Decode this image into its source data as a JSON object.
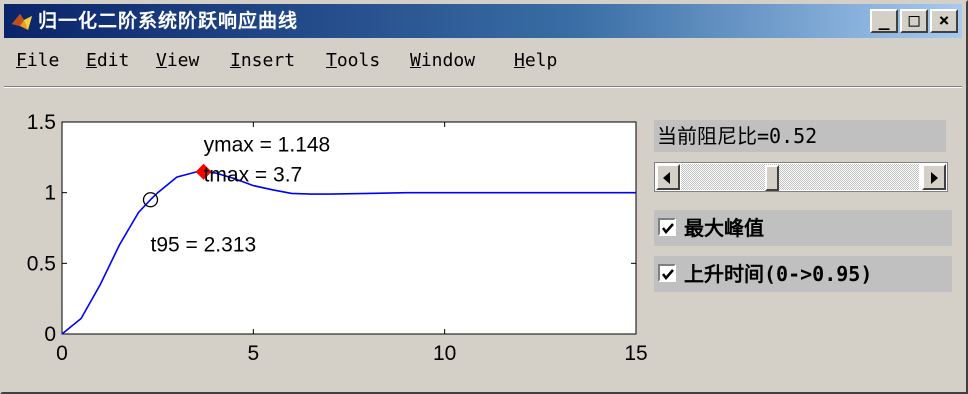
{
  "window": {
    "title": "归一化二阶系统阶跃响应曲线",
    "controls": {
      "minimize": "_",
      "maximize": "□",
      "close": "×"
    }
  },
  "menu": {
    "items": [
      {
        "id": "file",
        "label": "File"
      },
      {
        "id": "edit",
        "label": "Edit"
      },
      {
        "id": "view",
        "label": "View"
      },
      {
        "id": "insert",
        "label": "Insert"
      },
      {
        "id": "tools",
        "label": "Tools"
      },
      {
        "id": "window",
        "label": "Window"
      },
      {
        "id": "help",
        "label": "Help"
      }
    ]
  },
  "controls": {
    "damping_label": "当前阻尼比=0.52",
    "slider": {
      "value": 0.52,
      "min": 0,
      "max": 2
    },
    "checkbox_peak": {
      "label": "最大峰值",
      "checked": true
    },
    "checkbox_rise": {
      "label": "上升时间(0->0.95)",
      "checked": true
    }
  },
  "chart_data": {
    "type": "line",
    "xlim": [
      0,
      15
    ],
    "ylim": [
      0,
      1.5
    ],
    "xticks": [
      "0",
      "5",
      "10",
      "15"
    ],
    "yticks": [
      "0",
      "0.5",
      "1",
      "1.5"
    ],
    "grid": false,
    "series": [
      {
        "color": "#0000ff",
        "x": [
          0,
          0.5,
          1,
          1.5,
          2,
          2.313,
          2.5,
          3,
          3.5,
          3.7,
          4,
          4.5,
          5,
          5.5,
          6,
          6.5,
          7,
          8,
          9,
          10,
          11,
          12,
          13,
          14,
          15
        ],
        "y": [
          0,
          0.11,
          0.35,
          0.63,
          0.86,
          0.95,
          1.0,
          1.11,
          1.146,
          1.148,
          1.14,
          1.1,
          1.05,
          1.02,
          0.995,
          0.99,
          0.99,
          0.995,
          1.0,
          1.0,
          1.0,
          1.0,
          1.0,
          1.0,
          1.0
        ]
      }
    ],
    "markers": [
      {
        "type": "filled-diamond",
        "color": "#ff0000",
        "x": 3.7,
        "y": 1.148
      },
      {
        "type": "open-circle",
        "color": "#000000",
        "x": 2.313,
        "y": 0.95
      }
    ],
    "annotations": [
      {
        "id": "ymax",
        "text": "ymax = 1.148",
        "x": 3.7,
        "y": 1.148
      },
      {
        "id": "tmax",
        "text": "tmax = 3.7",
        "x": 3.7,
        "y": 1.148
      },
      {
        "id": "t95",
        "text": "t95 = 2.313",
        "x": 2.313,
        "y": 0.95
      }
    ]
  }
}
